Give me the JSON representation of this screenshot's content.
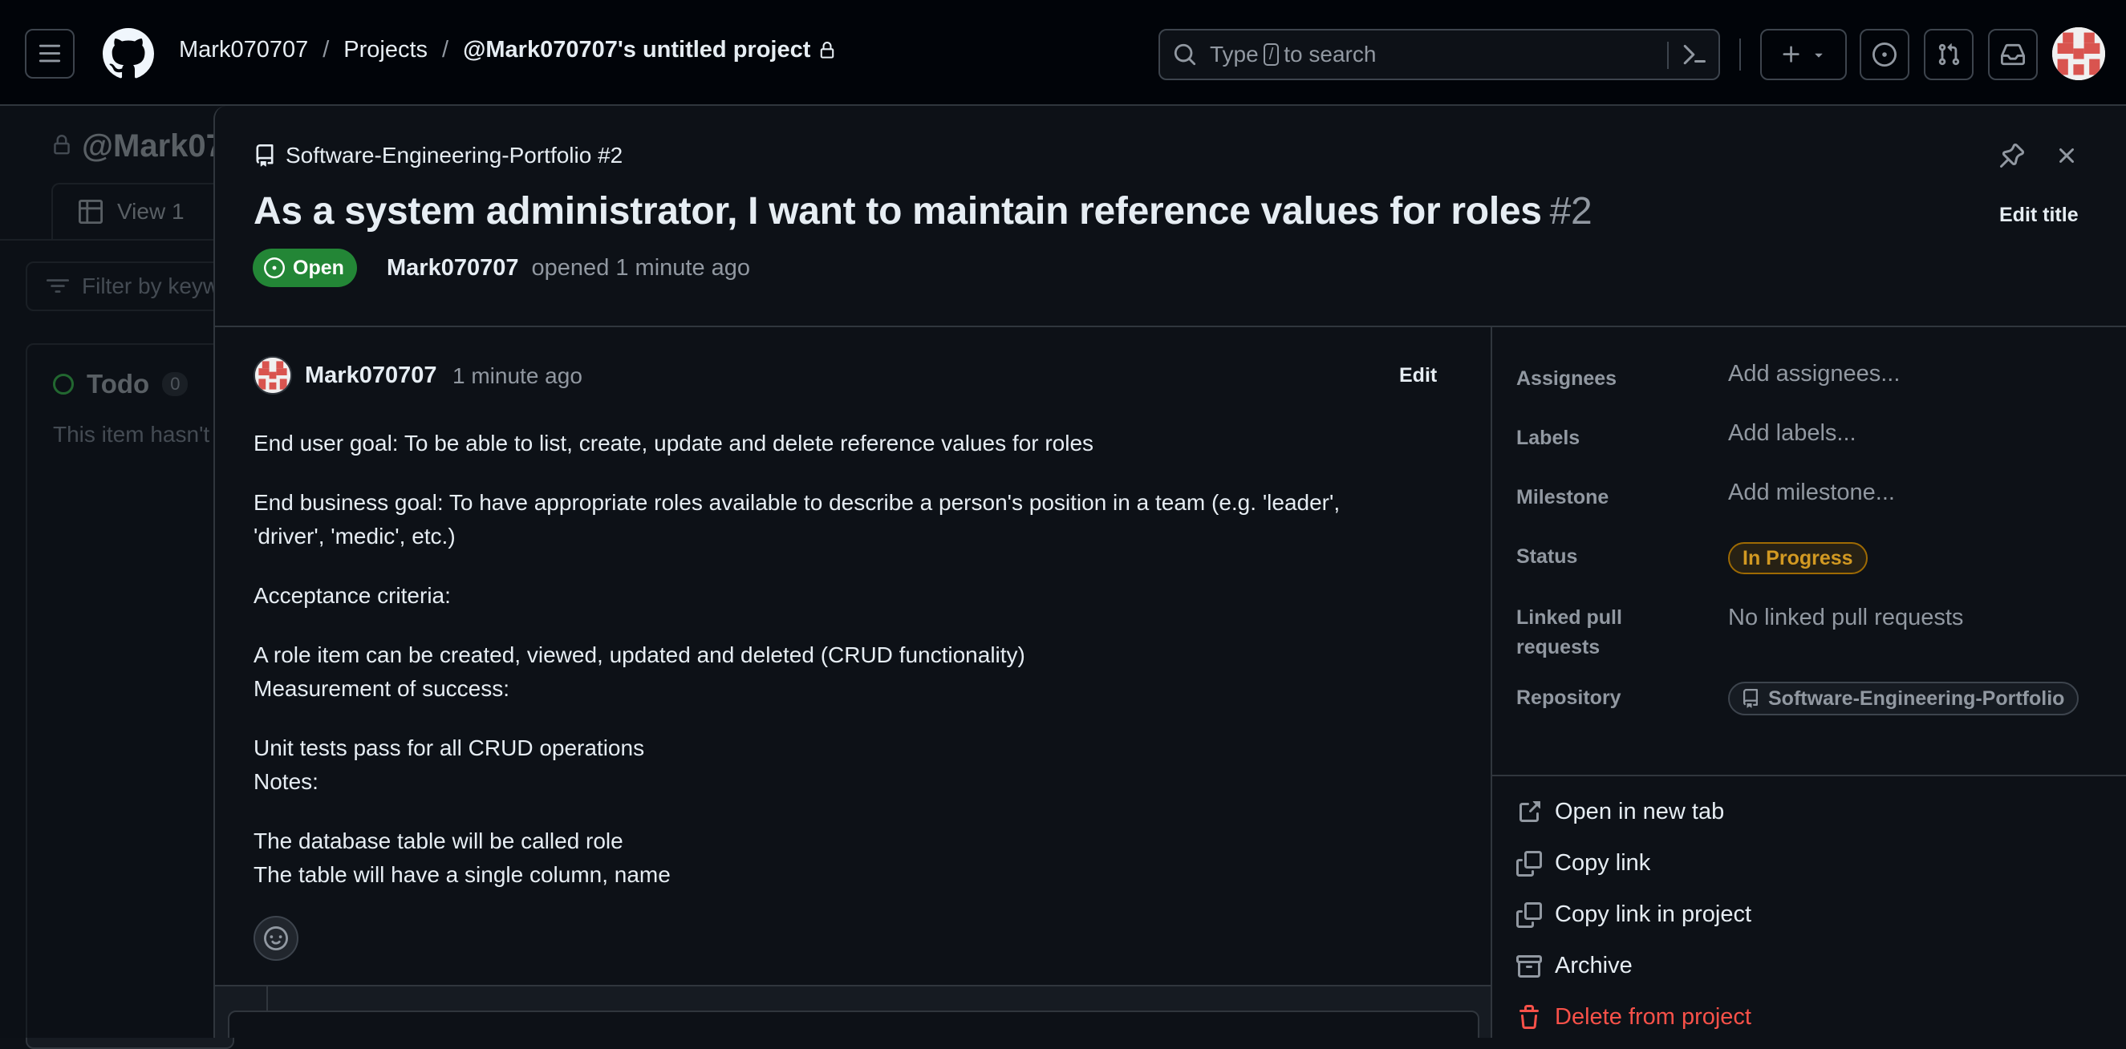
{
  "header": {
    "breadcrumbs": [
      "Mark070707",
      "Projects",
      "@Mark070707's untitled project"
    ],
    "separator": "/",
    "search_prefix": "Type",
    "search_key": "/",
    "search_suffix": "to search"
  },
  "background": {
    "project_title": "@Mark07",
    "view_tab": "View 1",
    "filter_placeholder": "Filter by keyw",
    "column_title": "Todo",
    "column_count": "0",
    "column_text": "This item hasn't"
  },
  "issue": {
    "repo_ref": "Software-Engineering-Portfolio #2",
    "title": "As a system administrator, I want to maintain reference values for roles",
    "number": "#2",
    "edit_title": "Edit title",
    "state": "Open",
    "author": "Mark070707",
    "opened_text": "opened 1 minute ago"
  },
  "comment": {
    "author": "Mark070707",
    "time": "1 minute ago",
    "edit_label": "Edit",
    "paragraphs": [
      [
        "End user goal: To be able to list, create, update and delete reference values for roles"
      ],
      [
        "End business goal: To have appropriate roles available to describe a person's position in a team (e.g. 'leader',",
        "'driver', 'medic', etc.)"
      ],
      [
        "Acceptance criteria:"
      ],
      [
        "A role item can be created, viewed, updated and deleted (CRUD functionality)",
        "Measurement of success:"
      ],
      [
        "Unit tests pass for all CRUD operations",
        "Notes:"
      ],
      [
        "The database table will be called role",
        "The table will have a single column, name"
      ]
    ]
  },
  "sidebar": {
    "assignees_label": "Assignees",
    "assignees_value": "Add assignees...",
    "labels_label": "Labels",
    "labels_value": "Add labels...",
    "milestone_label": "Milestone",
    "milestone_value": "Add milestone...",
    "status_label": "Status",
    "status_value": "In Progress",
    "linked_label_1": "Linked pull",
    "linked_label_2": "requests",
    "linked_value": "No linked pull requests",
    "repository_label": "Repository",
    "repository_value": "Software-Engineering-Portfolio",
    "status_color": "#d29922"
  },
  "actions": {
    "open_new_tab": "Open in new tab",
    "copy_link": "Copy link",
    "copy_link_project": "Copy link in project",
    "archive": "Archive",
    "delete": "Delete from project"
  },
  "colors": {
    "open_badge": "#238636",
    "danger": "#f85149",
    "background": "#0d1117"
  }
}
